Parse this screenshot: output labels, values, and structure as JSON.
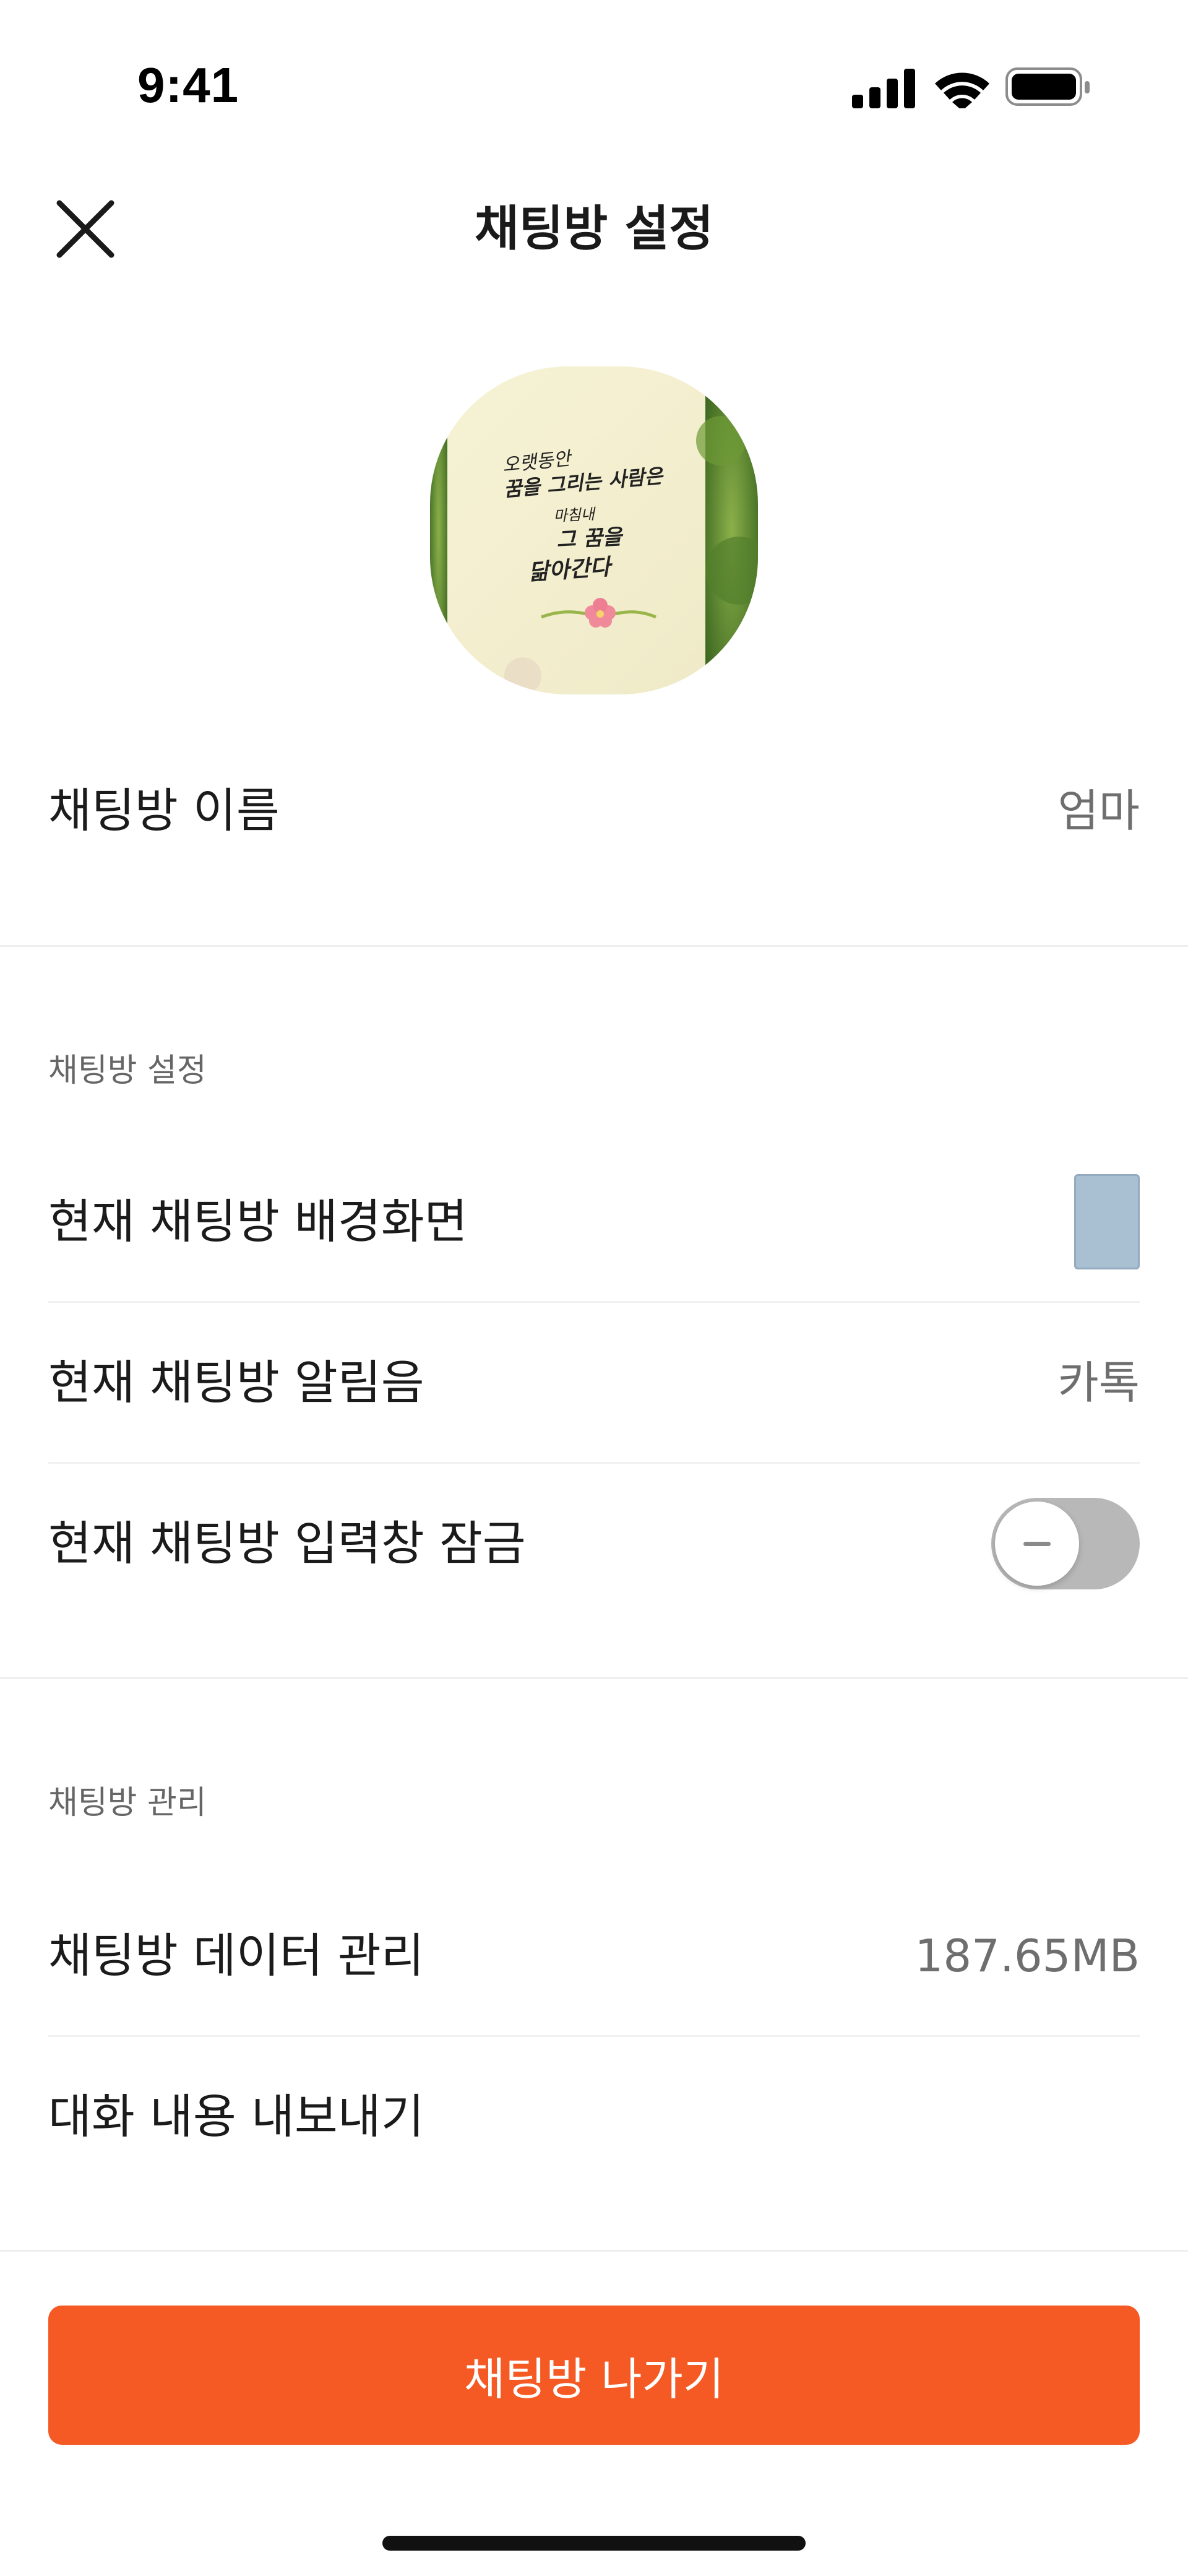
{
  "status_bar": {
    "time": "9:41",
    "icons": [
      "signal-icon",
      "wifi-icon",
      "battery-icon"
    ]
  },
  "nav": {
    "close_icon": "close-icon",
    "title": "채팅방 설정"
  },
  "avatar": {
    "calligraphy_lines": [
      "오랫동안",
      "꿈을 그리는 사람은",
      "마침내",
      "그 꿈을",
      "닮아간다"
    ]
  },
  "room_name": {
    "label": "채팅방 이름",
    "value": "엄마"
  },
  "settings_section": {
    "title": "채팅방 설정",
    "wallpaper_label": "현재 채팅방 배경화면",
    "wallpaper_color": "#a9bfd2",
    "sound_label": "현재 채팅방 알림음",
    "sound_value": "카톡",
    "lock_label": "현재 채팅방 입력창 잠금",
    "lock_enabled": false
  },
  "manage_section": {
    "title": "채팅방 관리",
    "data_label": "채팅방 데이터 관리",
    "data_value": "187.65MB",
    "export_label": "대화 내용 내보내기"
  },
  "footer": {
    "leave_label": "채팅방 나가기",
    "accent_color": "#f55a24"
  }
}
